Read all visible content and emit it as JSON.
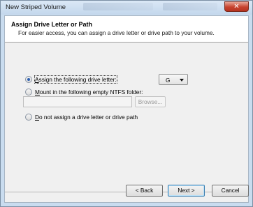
{
  "window": {
    "title": "New Striped Volume",
    "close_glyph": "✕"
  },
  "header": {
    "title": "Assign Drive Letter or Path",
    "subtitle": "For easier access, you can assign a drive letter or drive path to your volume."
  },
  "options": {
    "assign_letter": {
      "label": "Assign the following drive letter:",
      "selected": true
    },
    "mount_folder": {
      "label": "Mount in the following empty NTFS folder:",
      "selected": false
    },
    "no_assign": {
      "label": "Do not assign a drive letter or drive path",
      "selected": false
    }
  },
  "drive_letter": {
    "value": "G"
  },
  "folder_path": {
    "value": ""
  },
  "browse_label": "Browse...",
  "buttons": {
    "back": "< Back",
    "next": "Next >",
    "cancel": "Cancel"
  },
  "icons": {
    "close": "close-icon",
    "dropdown": "chevron-down-icon"
  },
  "colors": {
    "frame": "#c9dcef",
    "close_button": "#c7422e",
    "radio_dot": "#2c5fb0",
    "default_button_border": "#3c7fb1"
  }
}
